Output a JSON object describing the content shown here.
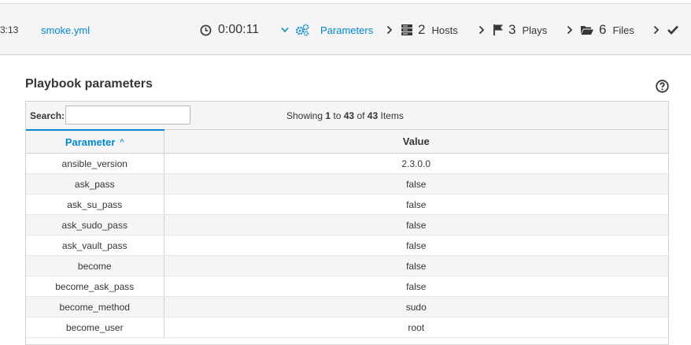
{
  "header": {
    "time_fragment": "3:13",
    "playbook": "smoke.yml",
    "duration": "0:00:11",
    "parameters_label": "Parameters",
    "hosts": {
      "count": "2",
      "label": "Hosts"
    },
    "plays": {
      "count": "3",
      "label": "Plays"
    },
    "files": {
      "count": "6",
      "label": "Files"
    }
  },
  "panel": {
    "title": "Playbook parameters"
  },
  "toolbar": {
    "search_label": "Search:",
    "search_value": "",
    "showing_prefix": "Showing ",
    "range_start": "1",
    "range_to": " to ",
    "range_end": "43",
    "range_of": " of ",
    "total": "43",
    "items_suffix": " Items"
  },
  "table": {
    "columns": [
      "Parameter",
      "Value"
    ],
    "rows": [
      {
        "parameter": "ansible_version",
        "value": "2.3.0.0"
      },
      {
        "parameter": "ask_pass",
        "value": "false"
      },
      {
        "parameter": "ask_su_pass",
        "value": "false"
      },
      {
        "parameter": "ask_sudo_pass",
        "value": "false"
      },
      {
        "parameter": "ask_vault_pass",
        "value": "false"
      },
      {
        "parameter": "become",
        "value": "false"
      },
      {
        "parameter": "become_ask_pass",
        "value": "false"
      },
      {
        "parameter": "become_method",
        "value": "sudo"
      },
      {
        "parameter": "become_user",
        "value": "root"
      }
    ]
  },
  "colors": {
    "accent": "#0088ce",
    "header_bg": "#f5f5f5",
    "border": "#d1d1d1"
  }
}
